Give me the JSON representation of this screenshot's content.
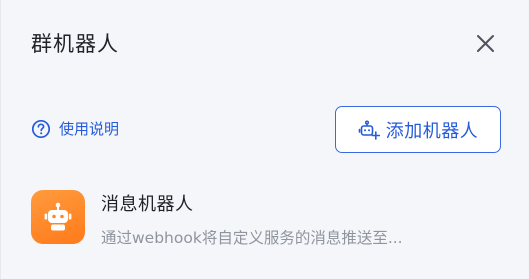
{
  "dialog": {
    "title": "群机器人",
    "close_icon": "close-icon"
  },
  "help": {
    "icon": "question-circle-icon",
    "label": "使用说明"
  },
  "add_button": {
    "icon": "add-robot-icon",
    "label": "添加机器人"
  },
  "bots": [
    {
      "name": "消息机器人",
      "description": "通过webhook将自定义服务的消息推送至...",
      "avatar_icon": "robot-icon"
    }
  ],
  "colors": {
    "accent": "#245bdb",
    "avatar_bg": "#ff8a2a",
    "text_primary": "#1f2329",
    "text_secondary": "#8f959e"
  }
}
